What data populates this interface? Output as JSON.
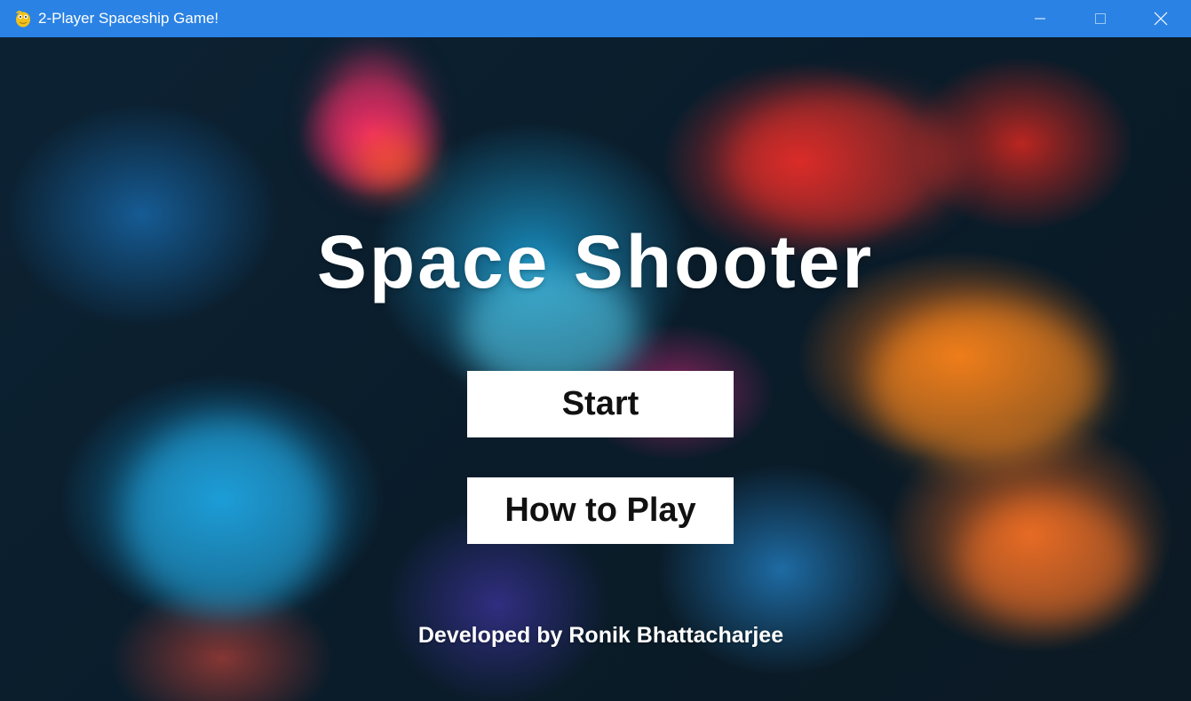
{
  "window": {
    "title": "2-Player Spaceship Game!",
    "icon": "python-snake-icon",
    "controls": [
      "minimize-icon",
      "maximize-icon",
      "close-icon"
    ],
    "titlebar_color": "#2a82e4"
  },
  "game": {
    "title": "Space Shooter",
    "buttons": {
      "start_label": "Start",
      "how_to_play_label": "How to Play"
    },
    "credit": "Developed by Ronik Bhattacharjee",
    "text_color": "#ffffff",
    "button_background": "#ffffff",
    "button_text_color": "#111111"
  }
}
